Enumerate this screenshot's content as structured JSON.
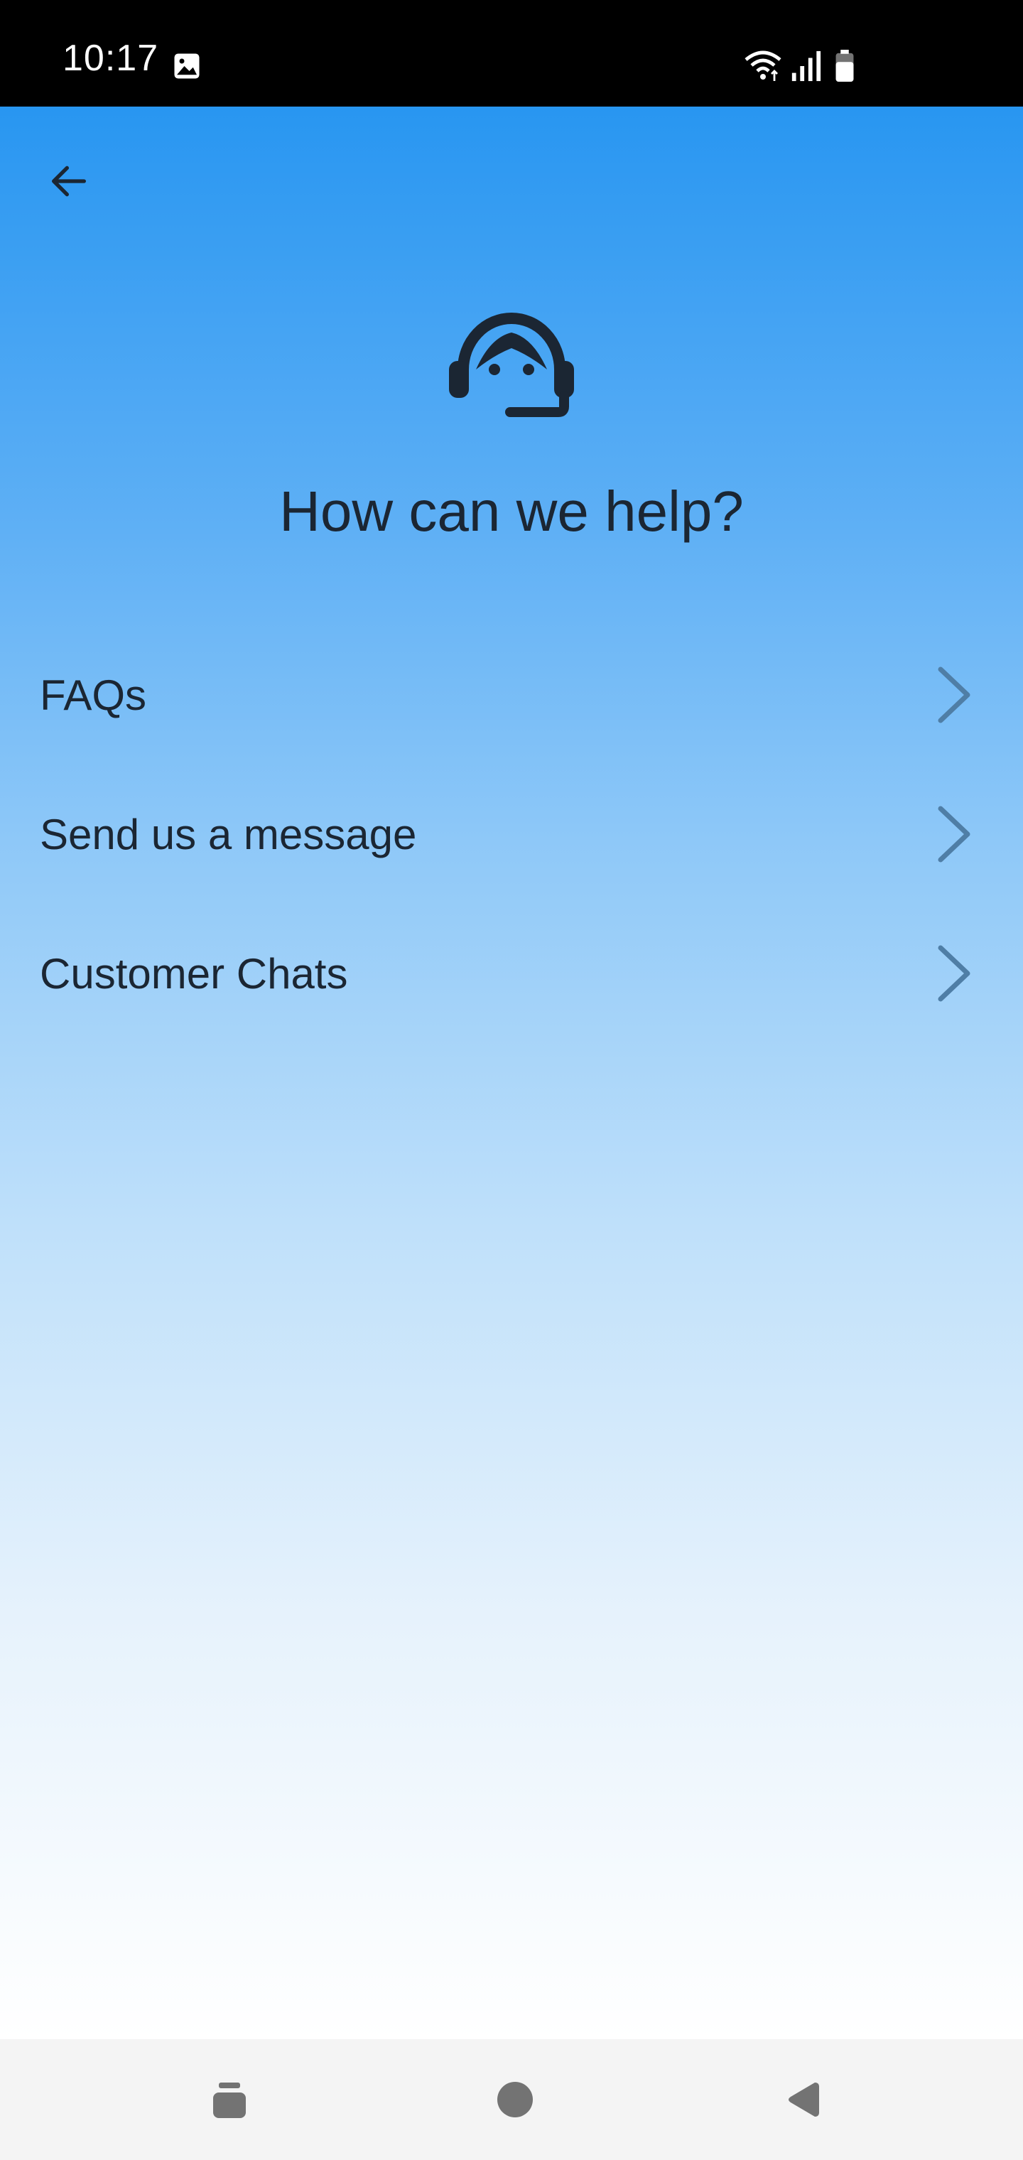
{
  "status_bar": {
    "time": "10:17",
    "icons": [
      "gallery-icon",
      "wifi-icon",
      "signal-icon",
      "battery-icon"
    ]
  },
  "header": {
    "back_icon": "arrow-left-icon",
    "hero_icon": "support-agent-icon",
    "title": "How can we help?"
  },
  "menu": {
    "items": [
      {
        "label": "FAQs",
        "icon": "chevron-right-icon"
      },
      {
        "label": "Send us a message",
        "icon": "chevron-right-icon"
      },
      {
        "label": "Customer Chats",
        "icon": "chevron-right-icon"
      }
    ]
  },
  "nav_bar": {
    "buttons": [
      "recent-apps-icon",
      "home-icon",
      "back-icon"
    ]
  },
  "colors": {
    "gradient_top": "#2896f1",
    "gradient_bottom": "#ffffff",
    "text": "#1b2633",
    "chevron": "#4f7ea6",
    "nav_bar": "#f4f4f4",
    "nav_icon": "#737373"
  }
}
